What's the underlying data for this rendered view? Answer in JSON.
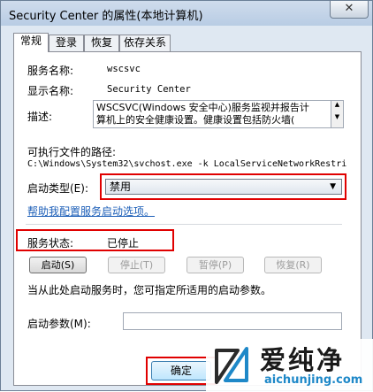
{
  "window": {
    "title": "Security Center 的属性(本地计算机)",
    "close_glyph": "✕"
  },
  "tabs": [
    "常规",
    "登录",
    "恢复",
    "依存关系"
  ],
  "general": {
    "service_name_label": "服务名称:",
    "service_name_value": "wscsvc",
    "display_name_label": "显示名称:",
    "display_name_value": "Security Center",
    "description_label": "描述:",
    "description_line1": "WSCSVC(Windows 安全中心)服务监视并报告计",
    "description_line2": "算机上的安全健康设置。健康设置包括防火墙(",
    "exec_path_label": "可执行文件的路径:",
    "exec_path_value": "C:\\Windows\\System32\\svchost.exe -k LocalServiceNetworkRestri",
    "startup_type_label": "启动类型(E):",
    "startup_type_value": "禁用",
    "help_link": "帮助我配置服务启动选项。",
    "status_label": "服务状态:",
    "status_value": "已停止",
    "start_button": "启动(S)",
    "stop_button": "停止(T)",
    "pause_button": "暂停(P)",
    "resume_button": "恢复(R)",
    "hint_text": "当从此处启动服务时，您可指定所适用的启动参数。",
    "start_params_label": "启动参数(M):",
    "start_params_value": ""
  },
  "footer": {
    "ok_button": "确定"
  },
  "watermark": {
    "brand": "爱纯净",
    "url": "aichunjing.com"
  },
  "colors": {
    "highlight_border": "#e00000",
    "link": "#1d5fb8",
    "watermark_url": "#1e88c8"
  }
}
